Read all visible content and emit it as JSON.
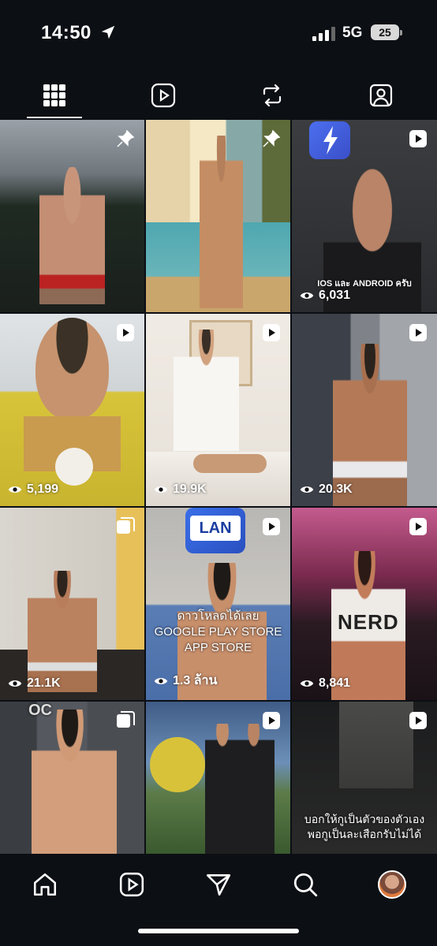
{
  "status_bar": {
    "time": "14:50",
    "network": "5G",
    "battery": "25"
  },
  "tabs": [
    {
      "name": "grid",
      "icon": "grid-icon",
      "active": true
    },
    {
      "name": "reels",
      "icon": "reels-icon",
      "active": false
    },
    {
      "name": "reposts",
      "icon": "repost-icon",
      "active": false
    },
    {
      "name": "tagged",
      "icon": "tagged-icon",
      "active": false
    }
  ],
  "posts": [
    {
      "badge": "pin-icon",
      "views": ""
    },
    {
      "badge": "pin-icon",
      "views": ""
    },
    {
      "badge": "reel-icon",
      "views": "6,031",
      "overlay": "IOS และ ANDROID ครับ"
    },
    {
      "badge": "reel-icon",
      "views": "5,199"
    },
    {
      "badge": "reel-icon",
      "views": "19.9K"
    },
    {
      "badge": "reel-icon",
      "views": "20.3K"
    },
    {
      "badge": "carousel-icon",
      "views": "21.1K"
    },
    {
      "badge": "reel-icon",
      "views": "1.3 ล้าน",
      "logo_text": "LAN",
      "overlay_lines": [
        "ดาวโหลดได้เลย",
        "GOOGLE PLAY STORE",
        "APP STORE"
      ]
    },
    {
      "badge": "reel-icon",
      "views": "8,841",
      "shirt_text": "NERD"
    },
    {
      "badge": "carousel-icon",
      "views": "",
      "corner_text": "OC"
    },
    {
      "badge": "reel-icon",
      "views": ""
    },
    {
      "badge": "reel-icon",
      "views": "",
      "caption_lines": [
        "บอกให้กูเป็นตัวของตัวเอง",
        "พอกูเป็นละเสือกรับไม่ได้"
      ]
    }
  ],
  "bottom_nav": [
    "home-icon",
    "reels-icon",
    "messages-icon",
    "search-icon",
    "profile-avatar"
  ]
}
